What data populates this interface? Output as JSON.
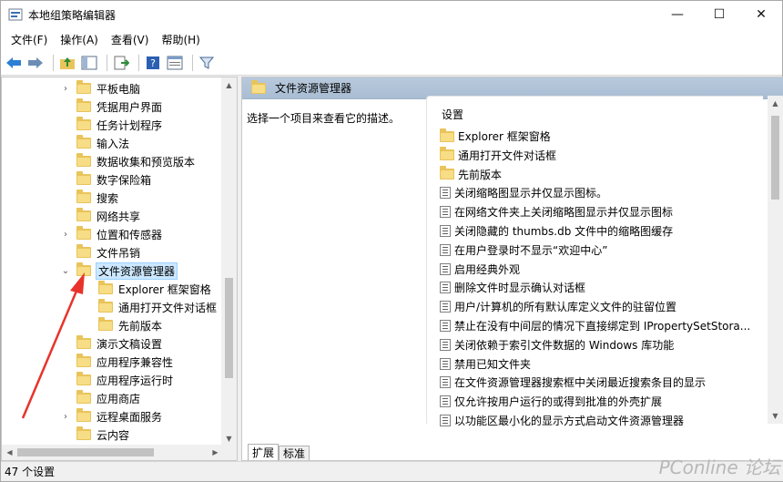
{
  "window": {
    "title": "本地组策略编辑器",
    "controls": [
      "—",
      "☐",
      "✕"
    ]
  },
  "menu": [
    "文件(F)",
    "操作(A)",
    "查看(V)",
    "帮助(H)"
  ],
  "tree": {
    "items": [
      {
        "label": "平板电脑",
        "expandable": true
      },
      {
        "label": "凭据用户界面",
        "expandable": false
      },
      {
        "label": "任务计划程序",
        "expandable": false
      },
      {
        "label": "输入法",
        "expandable": false
      },
      {
        "label": "数据收集和预览版本",
        "expandable": false
      },
      {
        "label": "数字保险箱",
        "expandable": false
      },
      {
        "label": "搜索",
        "expandable": false
      },
      {
        "label": "网络共享",
        "expandable": false
      },
      {
        "label": "位置和传感器",
        "expandable": true
      },
      {
        "label": "文件吊销",
        "expandable": false
      },
      {
        "label": "文件资源管理器",
        "expandable": true,
        "expanded": true,
        "selected": true
      },
      {
        "label": "Explorer 框架窗格",
        "child": true
      },
      {
        "label": "通用打开文件对话框",
        "child": true
      },
      {
        "label": "先前版本",
        "child": true
      },
      {
        "label": "演示文稿设置",
        "expandable": false
      },
      {
        "label": "应用程序兼容性",
        "expandable": false
      },
      {
        "label": "应用程序运行时",
        "expandable": false
      },
      {
        "label": "应用商店",
        "expandable": false
      },
      {
        "label": "远程桌面服务",
        "expandable": true
      },
      {
        "label": "云内容",
        "expandable": false
      }
    ]
  },
  "details": {
    "header": "文件资源管理器",
    "description": "选择一个项目来查看它的描述。",
    "column_header": "设置",
    "folders": [
      "Explorer 框架窗格",
      "通用打开文件对话框",
      "先前版本"
    ],
    "settings": [
      "关闭缩略图显示并仅显示图标。",
      "在网络文件夹上关闭缩略图显示并仅显示图标",
      "关闭隐藏的 thumbs.db 文件中的缩略图缓存",
      "在用户登录时不显示“欢迎中心”",
      "启用经典外观",
      "删除文件时显示确认对话框",
      "用户/计算机的所有默认库定义文件的驻留位置",
      "禁止在没有中间层的情况下直接绑定到 IPropertySetStora...",
      "关闭依赖于索引文件数据的 Windows 库功能",
      "禁用已知文件夹",
      "在文件资源管理器搜索框中关闭最近搜索条目的显示",
      "仅允许按用户运行的或得到批准的外壳扩展",
      "以功能区最小化的显示方式启动文件资源管理器"
    ],
    "tabs": [
      "扩展",
      "标准"
    ]
  },
  "status": "47 个设置",
  "watermark": "PConline 论坛",
  "colors": {
    "accent": "#e8332b",
    "folder": "#e9c45a",
    "header": "#b8c9dc"
  }
}
